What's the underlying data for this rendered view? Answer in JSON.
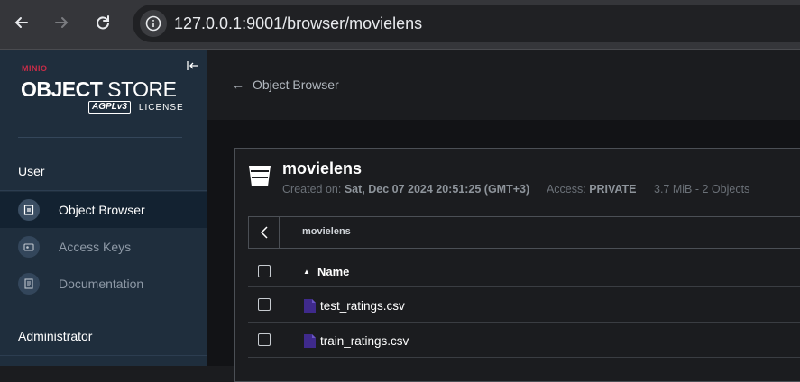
{
  "browser": {
    "url_host": "127.0.0.1",
    "url_path": ":9001/browser/movielens"
  },
  "sidebar": {
    "logo_brand": "MINIO",
    "logo_product_bold": "OBJECT",
    "logo_product_light": " STORE",
    "logo_agpl": "AGPLv3",
    "logo_license": "LICENSE",
    "sections": {
      "user": "User",
      "administrator": "Administrator"
    },
    "items": [
      {
        "label": "Object Browser",
        "icon": "object-browser-icon",
        "active": true
      },
      {
        "label": "Access Keys",
        "icon": "access-keys-icon",
        "active": false
      },
      {
        "label": "Documentation",
        "icon": "documentation-icon",
        "active": false
      }
    ]
  },
  "header": {
    "back_label": "Object Browser"
  },
  "bucket": {
    "name": "movielens",
    "created_label": "Created on:",
    "created_value": "Sat, Dec 07 2024 20:51:25 (GMT+3)",
    "access_label": "Access:",
    "access_value": "PRIVATE",
    "size_info": "3.7 MiB - 2 Objects"
  },
  "breadcrumb": {
    "path": "movielens"
  },
  "table": {
    "column_name": "Name",
    "rows": [
      {
        "name": "test_ratings.csv"
      },
      {
        "name": "train_ratings.csv"
      }
    ]
  },
  "colors": {
    "sidebar_bg": "#1f2e3d",
    "brand_red": "#c72c48",
    "file_icon": "#3f2a8c"
  }
}
